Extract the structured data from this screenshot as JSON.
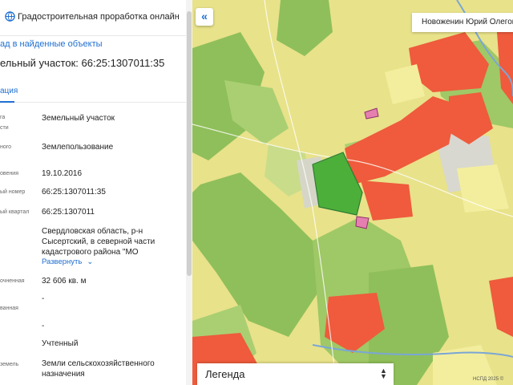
{
  "app": {
    "title": "Градостроительная проработка онлайн"
  },
  "nav": {
    "back_label": "ад в найденные объекты"
  },
  "parcel": {
    "title": "ельный участок: 66:25:1307011:35",
    "tab_label": "ация",
    "expand_label": "Развернуть",
    "fields": [
      {
        "label": "га",
        "value": "Земельный участок"
      },
      {
        "label": "сти",
        "value": ""
      },
      {
        "label": "ного",
        "value": "Землепользование"
      },
      {
        "label": "овения",
        "value": "19.10.2016"
      },
      {
        "label": "ый номер",
        "value": "66:25:1307011:35"
      },
      {
        "label": "ый квартал",
        "value": "66:25:1307011"
      },
      {
        "label": "",
        "value": "Свердловская область, р-н Сысертский, в северной части кадастрового района \"МО"
      },
      {
        "label": "очненная",
        "value": "32 606 кв. м"
      },
      {
        "label": "ванная",
        "value": "-"
      },
      {
        "label": "",
        "value": "-"
      },
      {
        "label": "",
        "value": "Учтенный"
      },
      {
        "label": "земель",
        "value": "Земли сельскохозяйственного назначения"
      }
    ]
  },
  "map": {
    "user_name": "Новоженин Юрий Олегов",
    "legend_label": "Легенда",
    "copyright": "НСПД 2025 ©",
    "colors": {
      "agricultural": "#e8e28a",
      "forest": "#8fbf5a",
      "residential": "#ef5b3c",
      "selected_parcel": "#4caf3a"
    }
  },
  "icons": {
    "collapse": "double-chevron-left-icon",
    "expand": "chevron-down-icon",
    "legend_toggle": "sort-icon",
    "app": "globe-icon"
  }
}
